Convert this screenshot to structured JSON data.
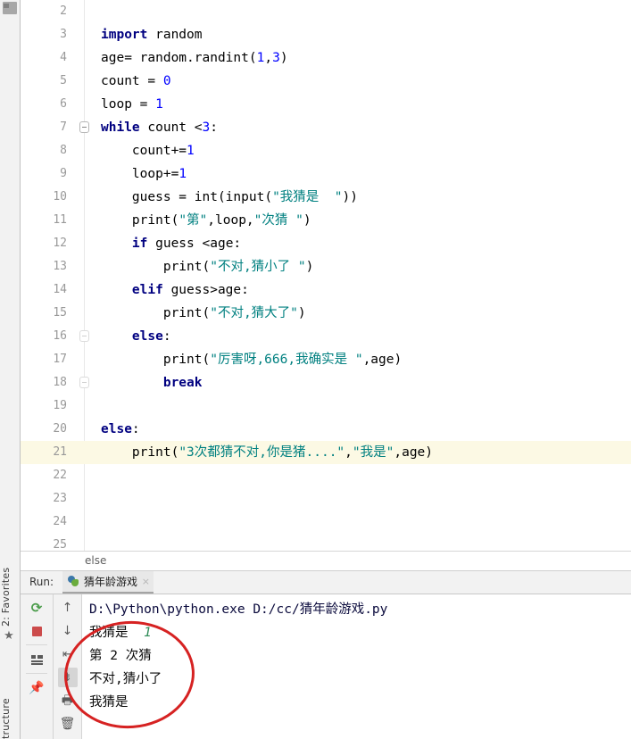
{
  "window": {
    "ide": "PyCharm",
    "left_strip": {
      "favorites_label": "2: Favorites",
      "structure_label": "tructure",
      "star_glyph": "★"
    }
  },
  "editor": {
    "first_visible_line": 2,
    "current_line": 21,
    "lines": [
      {
        "n": 2,
        "fold": "",
        "text": ""
      },
      {
        "n": 3,
        "fold": "",
        "tokens": [
          {
            "t": "import",
            "c": "kw"
          },
          {
            "t": " random",
            "c": "plain"
          }
        ]
      },
      {
        "n": 4,
        "fold": "",
        "tokens": [
          {
            "t": "age= random.randint(",
            "c": "plain"
          },
          {
            "t": "1",
            "c": "num"
          },
          {
            "t": ",",
            "c": "plain"
          },
          {
            "t": "3",
            "c": "num"
          },
          {
            "t": ")",
            "c": "plain"
          }
        ]
      },
      {
        "n": 5,
        "fold": "",
        "tokens": [
          {
            "t": "count = ",
            "c": "plain"
          },
          {
            "t": "0",
            "c": "num"
          }
        ]
      },
      {
        "n": 6,
        "fold": "",
        "tokens": [
          {
            "t": "loop = ",
            "c": "plain"
          },
          {
            "t": "1",
            "c": "num"
          }
        ]
      },
      {
        "n": 7,
        "fold": "minus",
        "tokens": [
          {
            "t": "while",
            "c": "kw"
          },
          {
            "t": " count <",
            "c": "plain"
          },
          {
            "t": "3",
            "c": "num"
          },
          {
            "t": ":",
            "c": "plain"
          }
        ]
      },
      {
        "n": 8,
        "fold": "",
        "tokens": [
          {
            "t": "    count+=",
            "c": "plain"
          },
          {
            "t": "1",
            "c": "num"
          }
        ]
      },
      {
        "n": 9,
        "fold": "",
        "tokens": [
          {
            "t": "    loop+=",
            "c": "plain"
          },
          {
            "t": "1",
            "c": "num"
          }
        ]
      },
      {
        "n": 10,
        "fold": "",
        "tokens": [
          {
            "t": "    guess = int(input(",
            "c": "plain"
          },
          {
            "t": "\"我猜是  \"",
            "c": "str"
          },
          {
            "t": "))",
            "c": "plain"
          }
        ]
      },
      {
        "n": 11,
        "fold": "",
        "tokens": [
          {
            "t": "    print(",
            "c": "plain"
          },
          {
            "t": "\"第\"",
            "c": "str"
          },
          {
            "t": ",loop,",
            "c": "plain"
          },
          {
            "t": "\"次猜 \"",
            "c": "str"
          },
          {
            "t": ")",
            "c": "plain"
          }
        ]
      },
      {
        "n": 12,
        "fold": "",
        "tokens": [
          {
            "t": "    ",
            "c": "plain"
          },
          {
            "t": "if",
            "c": "kw"
          },
          {
            "t": " guess <age:",
            "c": "plain"
          }
        ]
      },
      {
        "n": 13,
        "fold": "",
        "tokens": [
          {
            "t": "        print(",
            "c": "plain"
          },
          {
            "t": "\"不对,猜小了 \"",
            "c": "str"
          },
          {
            "t": ")",
            "c": "plain"
          }
        ]
      },
      {
        "n": 14,
        "fold": "",
        "tokens": [
          {
            "t": "    ",
            "c": "plain"
          },
          {
            "t": "elif",
            "c": "kw"
          },
          {
            "t": " guess>age:",
            "c": "plain"
          }
        ]
      },
      {
        "n": 15,
        "fold": "",
        "tokens": [
          {
            "t": "        print(",
            "c": "plain"
          },
          {
            "t": "\"不对,猜大了\"",
            "c": "str"
          },
          {
            "t": ")",
            "c": "plain"
          }
        ]
      },
      {
        "n": 16,
        "fold": "faint",
        "tokens": [
          {
            "t": "    ",
            "c": "plain"
          },
          {
            "t": "else",
            "c": "kw"
          },
          {
            "t": ":",
            "c": "plain"
          }
        ]
      },
      {
        "n": 17,
        "fold": "",
        "tokens": [
          {
            "t": "        print(",
            "c": "plain"
          },
          {
            "t": "\"厉害呀,666,我确实是 \"",
            "c": "str"
          },
          {
            "t": ",age)",
            "c": "plain"
          }
        ]
      },
      {
        "n": 18,
        "fold": "faint",
        "tokens": [
          {
            "t": "        ",
            "c": "plain"
          },
          {
            "t": "break",
            "c": "kw"
          }
        ]
      },
      {
        "n": 19,
        "fold": "",
        "text": ""
      },
      {
        "n": 20,
        "fold": "",
        "tokens": [
          {
            "t": "else",
            "c": "kw"
          },
          {
            "t": ":",
            "c": "plain"
          }
        ]
      },
      {
        "n": 21,
        "fold": "",
        "tokens": [
          {
            "t": "    print(",
            "c": "plain"
          },
          {
            "t": "\"3次都猜不对,你是猪....\"",
            "c": "str"
          },
          {
            "t": ",",
            "c": "plain"
          },
          {
            "t": "\"我是\"",
            "c": "str"
          },
          {
            "t": ",age)",
            "c": "plain"
          }
        ]
      },
      {
        "n": 22,
        "fold": "",
        "text": ""
      },
      {
        "n": 23,
        "fold": "",
        "text": ""
      },
      {
        "n": 24,
        "fold": "",
        "text": ""
      },
      {
        "n": 25,
        "fold": "",
        "text": ""
      }
    ]
  },
  "breadcrumb": {
    "item": "else"
  },
  "run_tool": {
    "label": "Run:",
    "tab_title": "猜年龄游戏",
    "close_glyph": "×",
    "actions_left": [
      {
        "name": "rerun",
        "glyph": "⟳"
      },
      {
        "name": "stop",
        "glyph": ""
      },
      {
        "name": "show-grid",
        "glyph": ""
      },
      {
        "name": "pin-tab",
        "glyph": "📌"
      }
    ],
    "actions_right": [
      {
        "name": "up",
        "glyph": "↑"
      },
      {
        "name": "down",
        "glyph": "↓"
      },
      {
        "name": "soft-wrap",
        "glyph": "⇥"
      },
      {
        "name": "scroll-to-end",
        "glyph": "⇟"
      },
      {
        "name": "print",
        "glyph": "🖶"
      },
      {
        "name": "clear-all",
        "glyph": "🗑"
      }
    ]
  },
  "console": {
    "lines": [
      {
        "kind": "cmd",
        "text": "D:\\Python\\python.exe D:/cc/猜年龄游戏.py"
      },
      {
        "kind": "prompt",
        "text": "我猜是  ",
        "input": "1"
      },
      {
        "kind": "out",
        "text": "第 2 次猜"
      },
      {
        "kind": "out",
        "text": "不对,猜小了"
      },
      {
        "kind": "out",
        "text": "我猜是"
      }
    ]
  },
  "annotation": {
    "shape": "ellipse",
    "color": "#d62222"
  },
  "colors": {
    "keyword": "#000080",
    "string": "#008080",
    "number": "#0000ff",
    "current_line_bg": "#fcf9e4",
    "console_input": "#2e8b57",
    "annotation_red": "#d62222"
  }
}
